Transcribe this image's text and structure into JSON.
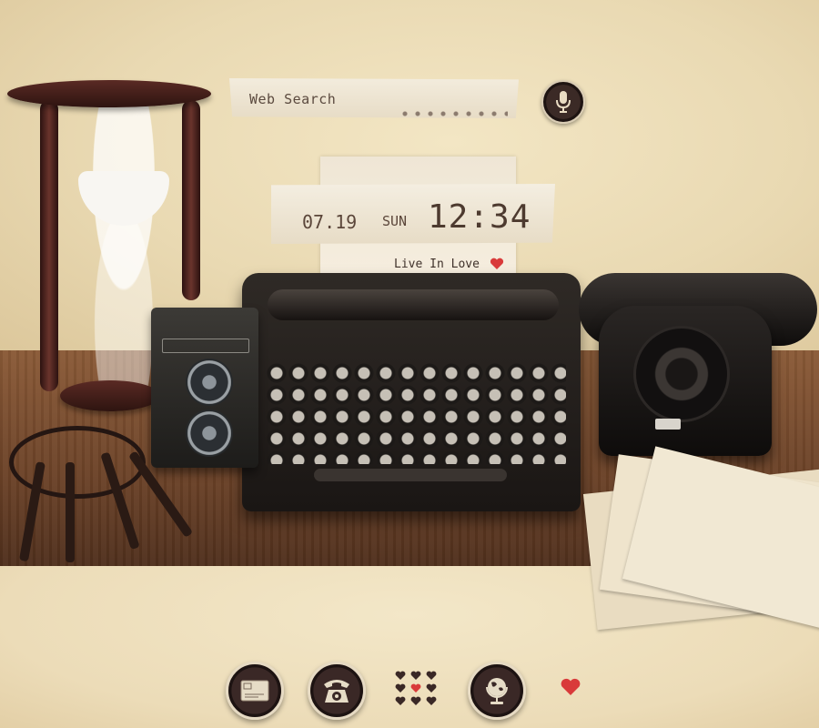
{
  "search": {
    "placeholder_text": "Web Search",
    "mic_icon": "microphone-icon"
  },
  "clock": {
    "date": "07.19",
    "day": "SUN",
    "time": "12:34",
    "tagline": "Live In Love"
  },
  "dock": {
    "items": [
      {
        "name": "mail-app",
        "icon": "envelope-icon"
      },
      {
        "name": "phone-app",
        "icon": "rotary-phone-icon"
      },
      {
        "name": "app-drawer",
        "icon": "heart-grid-icon"
      },
      {
        "name": "browser-app",
        "icon": "globe-icon"
      },
      {
        "name": "favorites",
        "icon": "heart-icon"
      }
    ]
  },
  "colors": {
    "accent": "#d93a3a",
    "dark_button": "#3a2826",
    "paper": "#f3ecdd"
  }
}
